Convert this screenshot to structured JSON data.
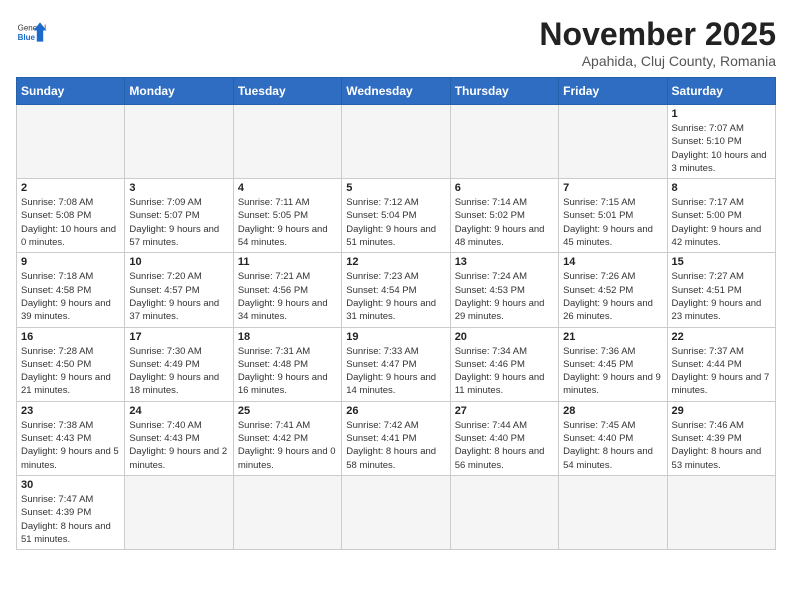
{
  "logo": {
    "general": "General",
    "blue": "Blue"
  },
  "title": "November 2025",
  "subtitle": "Apahida, Cluj County, Romania",
  "days_of_week": [
    "Sunday",
    "Monday",
    "Tuesday",
    "Wednesday",
    "Thursday",
    "Friday",
    "Saturday"
  ],
  "weeks": [
    [
      {
        "day": "",
        "info": ""
      },
      {
        "day": "",
        "info": ""
      },
      {
        "day": "",
        "info": ""
      },
      {
        "day": "",
        "info": ""
      },
      {
        "day": "",
        "info": ""
      },
      {
        "day": "",
        "info": ""
      },
      {
        "day": "1",
        "info": "Sunrise: 7:07 AM\nSunset: 5:10 PM\nDaylight: 10 hours and 3 minutes."
      }
    ],
    [
      {
        "day": "2",
        "info": "Sunrise: 7:08 AM\nSunset: 5:08 PM\nDaylight: 10 hours and 0 minutes."
      },
      {
        "day": "3",
        "info": "Sunrise: 7:09 AM\nSunset: 5:07 PM\nDaylight: 9 hours and 57 minutes."
      },
      {
        "day": "4",
        "info": "Sunrise: 7:11 AM\nSunset: 5:05 PM\nDaylight: 9 hours and 54 minutes."
      },
      {
        "day": "5",
        "info": "Sunrise: 7:12 AM\nSunset: 5:04 PM\nDaylight: 9 hours and 51 minutes."
      },
      {
        "day": "6",
        "info": "Sunrise: 7:14 AM\nSunset: 5:02 PM\nDaylight: 9 hours and 48 minutes."
      },
      {
        "day": "7",
        "info": "Sunrise: 7:15 AM\nSunset: 5:01 PM\nDaylight: 9 hours and 45 minutes."
      },
      {
        "day": "8",
        "info": "Sunrise: 7:17 AM\nSunset: 5:00 PM\nDaylight: 9 hours and 42 minutes."
      }
    ],
    [
      {
        "day": "9",
        "info": "Sunrise: 7:18 AM\nSunset: 4:58 PM\nDaylight: 9 hours and 39 minutes."
      },
      {
        "day": "10",
        "info": "Sunrise: 7:20 AM\nSunset: 4:57 PM\nDaylight: 9 hours and 37 minutes."
      },
      {
        "day": "11",
        "info": "Sunrise: 7:21 AM\nSunset: 4:56 PM\nDaylight: 9 hours and 34 minutes."
      },
      {
        "day": "12",
        "info": "Sunrise: 7:23 AM\nSunset: 4:54 PM\nDaylight: 9 hours and 31 minutes."
      },
      {
        "day": "13",
        "info": "Sunrise: 7:24 AM\nSunset: 4:53 PM\nDaylight: 9 hours and 29 minutes."
      },
      {
        "day": "14",
        "info": "Sunrise: 7:26 AM\nSunset: 4:52 PM\nDaylight: 9 hours and 26 minutes."
      },
      {
        "day": "15",
        "info": "Sunrise: 7:27 AM\nSunset: 4:51 PM\nDaylight: 9 hours and 23 minutes."
      }
    ],
    [
      {
        "day": "16",
        "info": "Sunrise: 7:28 AM\nSunset: 4:50 PM\nDaylight: 9 hours and 21 minutes."
      },
      {
        "day": "17",
        "info": "Sunrise: 7:30 AM\nSunset: 4:49 PM\nDaylight: 9 hours and 18 minutes."
      },
      {
        "day": "18",
        "info": "Sunrise: 7:31 AM\nSunset: 4:48 PM\nDaylight: 9 hours and 16 minutes."
      },
      {
        "day": "19",
        "info": "Sunrise: 7:33 AM\nSunset: 4:47 PM\nDaylight: 9 hours and 14 minutes."
      },
      {
        "day": "20",
        "info": "Sunrise: 7:34 AM\nSunset: 4:46 PM\nDaylight: 9 hours and 11 minutes."
      },
      {
        "day": "21",
        "info": "Sunrise: 7:36 AM\nSunset: 4:45 PM\nDaylight: 9 hours and 9 minutes."
      },
      {
        "day": "22",
        "info": "Sunrise: 7:37 AM\nSunset: 4:44 PM\nDaylight: 9 hours and 7 minutes."
      }
    ],
    [
      {
        "day": "23",
        "info": "Sunrise: 7:38 AM\nSunset: 4:43 PM\nDaylight: 9 hours and 5 minutes."
      },
      {
        "day": "24",
        "info": "Sunrise: 7:40 AM\nSunset: 4:43 PM\nDaylight: 9 hours and 2 minutes."
      },
      {
        "day": "25",
        "info": "Sunrise: 7:41 AM\nSunset: 4:42 PM\nDaylight: 9 hours and 0 minutes."
      },
      {
        "day": "26",
        "info": "Sunrise: 7:42 AM\nSunset: 4:41 PM\nDaylight: 8 hours and 58 minutes."
      },
      {
        "day": "27",
        "info": "Sunrise: 7:44 AM\nSunset: 4:40 PM\nDaylight: 8 hours and 56 minutes."
      },
      {
        "day": "28",
        "info": "Sunrise: 7:45 AM\nSunset: 4:40 PM\nDaylight: 8 hours and 54 minutes."
      },
      {
        "day": "29",
        "info": "Sunrise: 7:46 AM\nSunset: 4:39 PM\nDaylight: 8 hours and 53 minutes."
      }
    ],
    [
      {
        "day": "30",
        "info": "Sunrise: 7:47 AM\nSunset: 4:39 PM\nDaylight: 8 hours and 51 minutes."
      },
      {
        "day": "",
        "info": ""
      },
      {
        "day": "",
        "info": ""
      },
      {
        "day": "",
        "info": ""
      },
      {
        "day": "",
        "info": ""
      },
      {
        "day": "",
        "info": ""
      },
      {
        "day": "",
        "info": ""
      }
    ]
  ]
}
